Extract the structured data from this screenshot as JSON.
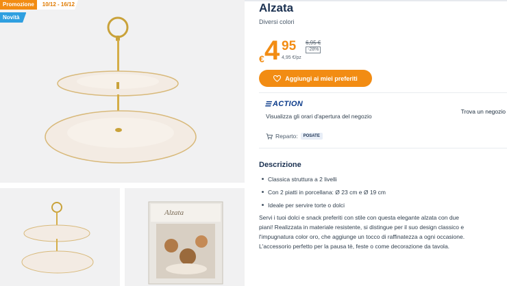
{
  "badges": {
    "promo_label": "Promozione",
    "promo_dates": "10/12 - 16/12",
    "new_label": "Novità"
  },
  "product": {
    "title": "Alzata",
    "subtitle": "Diversi colori",
    "price": {
      "currency": "€",
      "integer": "4",
      "decimal": "95",
      "unit_price": "4,95 €/pz",
      "old_price": "6,95 €",
      "discount": "-28%"
    }
  },
  "favorites_button": {
    "label": "Aggiungi ai miei preferiti",
    "icon": "heart-icon"
  },
  "store": {
    "logo_text": "ACTION",
    "hours_link": "Visualizza gli orari d'apertura del negozio",
    "find_store": "Trova un negozio",
    "department_label": "Reparto:",
    "department_value": "POSATE",
    "department_icon": "cart-icon"
  },
  "description": {
    "title": "Descrizione",
    "bullets": [
      "Classica struttura a 2 livelli",
      "Con 2 piatti in porcellana: Ø 23 cm e Ø 19 cm",
      "Ideale per servire torte o dolci"
    ],
    "lines": [
      "Servi i tuoi dolci e snack preferiti con stile con questa elegante alzata con due",
      "piani! Realizzata in materiale resistente, si distingue per il suo design classico e",
      "l'impugnatura color oro, che aggiunge un tocco di raffinatezza a ogni occasione.",
      "L'accessorio perfetto per la pausa tè, feste o come decorazione da tavola."
    ]
  },
  "gallery": {
    "box_label": "Alzata"
  },
  "colors": {
    "accent": "#f28c13",
    "new_badge": "#2f9fe0",
    "brand_blue": "#0a3a8a"
  }
}
